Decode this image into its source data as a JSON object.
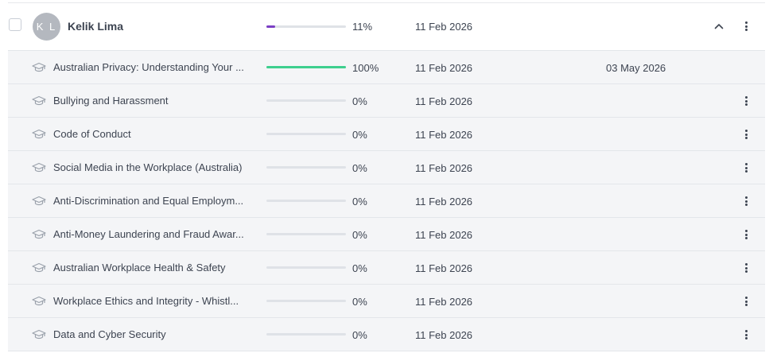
{
  "user": {
    "initials": "K L",
    "name": "Kelik Lima",
    "progress_percent": 11,
    "progress_label": "11%",
    "assigned_date": "11 Feb 2026",
    "expanded": true,
    "progress_color": "#7b3fc4"
  },
  "courses": [
    {
      "title": "Australian Privacy: Understanding Your ...",
      "progress_percent": 100,
      "progress_label": "100%",
      "assigned_date": "11 Feb 2026",
      "completed_date": "03 May 2026",
      "has_menu": false,
      "progress_color": "#3ecf8e"
    },
    {
      "title": "Bullying and Harassment",
      "progress_percent": 0,
      "progress_label": "0%",
      "assigned_date": "11 Feb 2026",
      "completed_date": "",
      "has_menu": true
    },
    {
      "title": "Code of Conduct",
      "progress_percent": 0,
      "progress_label": "0%",
      "assigned_date": "11 Feb 2026",
      "completed_date": "",
      "has_menu": true
    },
    {
      "title": "Social Media in the Workplace (Australia)",
      "progress_percent": 0,
      "progress_label": "0%",
      "assigned_date": "11 Feb 2026",
      "completed_date": "",
      "has_menu": true
    },
    {
      "title": "Anti-Discrimination and Equal Employm...",
      "progress_percent": 0,
      "progress_label": "0%",
      "assigned_date": "11 Feb 2026",
      "completed_date": "",
      "has_menu": true
    },
    {
      "title": "Anti-Money Laundering and Fraud Awar...",
      "progress_percent": 0,
      "progress_label": "0%",
      "assigned_date": "11 Feb 2026",
      "completed_date": "",
      "has_menu": true
    },
    {
      "title": "Australian Workplace Health & Safety",
      "progress_percent": 0,
      "progress_label": "0%",
      "assigned_date": "11 Feb 2026",
      "completed_date": "",
      "has_menu": true
    },
    {
      "title": "Workplace Ethics and Integrity - Whistl...",
      "progress_percent": 0,
      "progress_label": "0%",
      "assigned_date": "11 Feb 2026",
      "completed_date": "",
      "has_menu": true
    },
    {
      "title": "Data and Cyber Security",
      "progress_percent": 0,
      "progress_label": "0%",
      "assigned_date": "11 Feb 2026",
      "completed_date": "",
      "has_menu": true
    }
  ],
  "icons": {
    "course": "graduation-cap-icon",
    "row_menu": "more-vertical-icon",
    "collapse": "chevron-up-icon"
  }
}
